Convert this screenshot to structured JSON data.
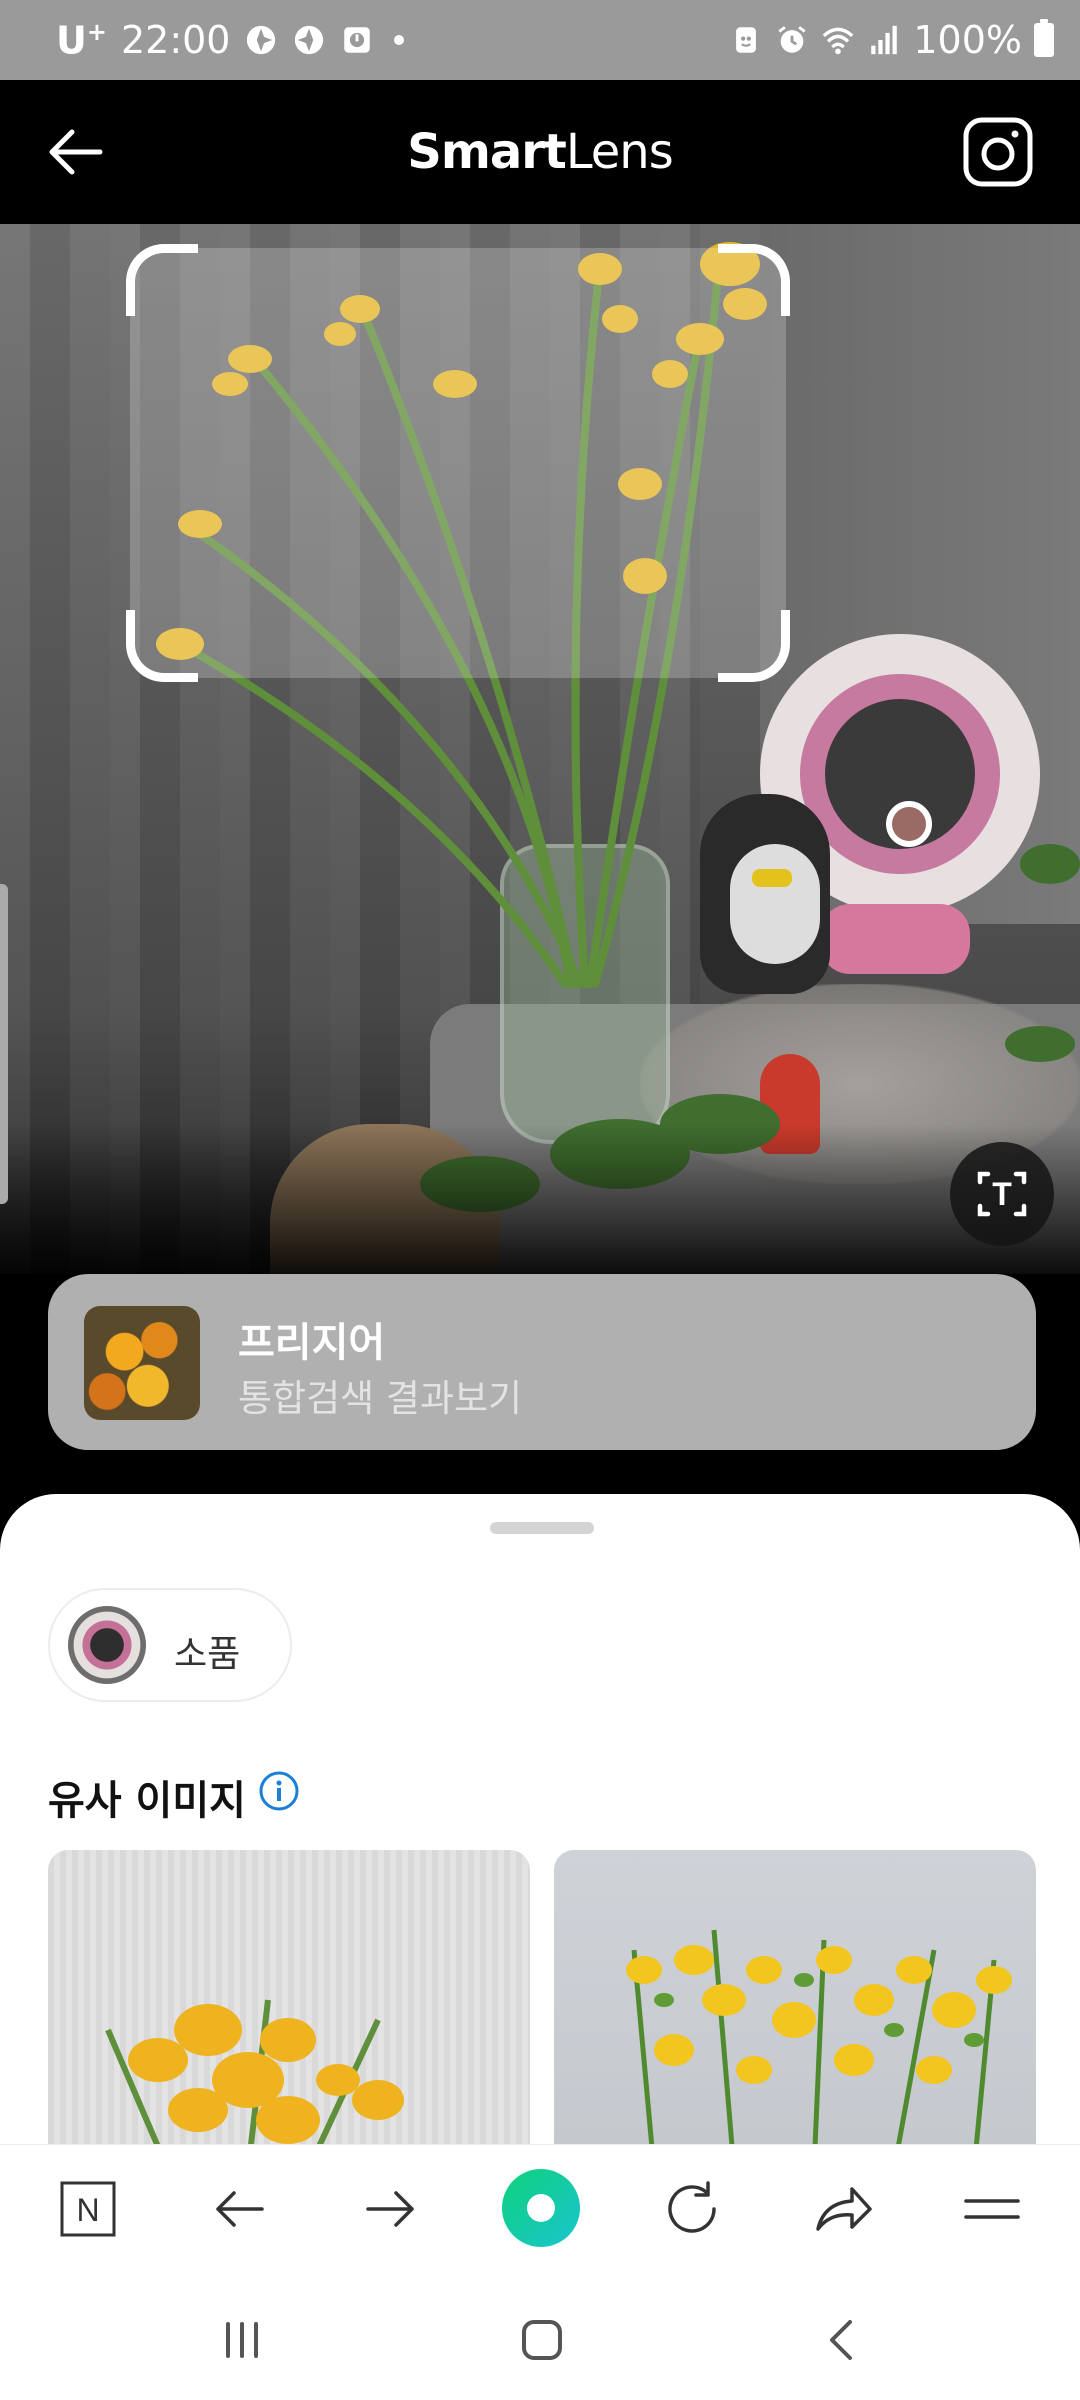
{
  "status_bar": {
    "carrier": "U",
    "carrier_sup": "+",
    "time": "22:00",
    "battery": "100%"
  },
  "header": {
    "title_bold": "Smart",
    "title_regular": "Lens"
  },
  "camera": {
    "object_marker": "object-dot",
    "text_scan_label": "T"
  },
  "result_card": {
    "title": "프리지어",
    "subtitle": "통합검색 결과보기"
  },
  "sheet": {
    "chip_label": "소품",
    "section_title": "유사 이미지"
  },
  "toolbar": {
    "naver_label": "N",
    "items": [
      "naver-icon",
      "back-arrow-icon",
      "forward-arrow-icon",
      "green-dot-icon",
      "refresh-icon",
      "share-icon",
      "menu-icon"
    ]
  },
  "colors": {
    "accent_green": "#0fd17a",
    "info_blue": "#1a7fd6",
    "result_card_bg": "#b0b0b0"
  }
}
